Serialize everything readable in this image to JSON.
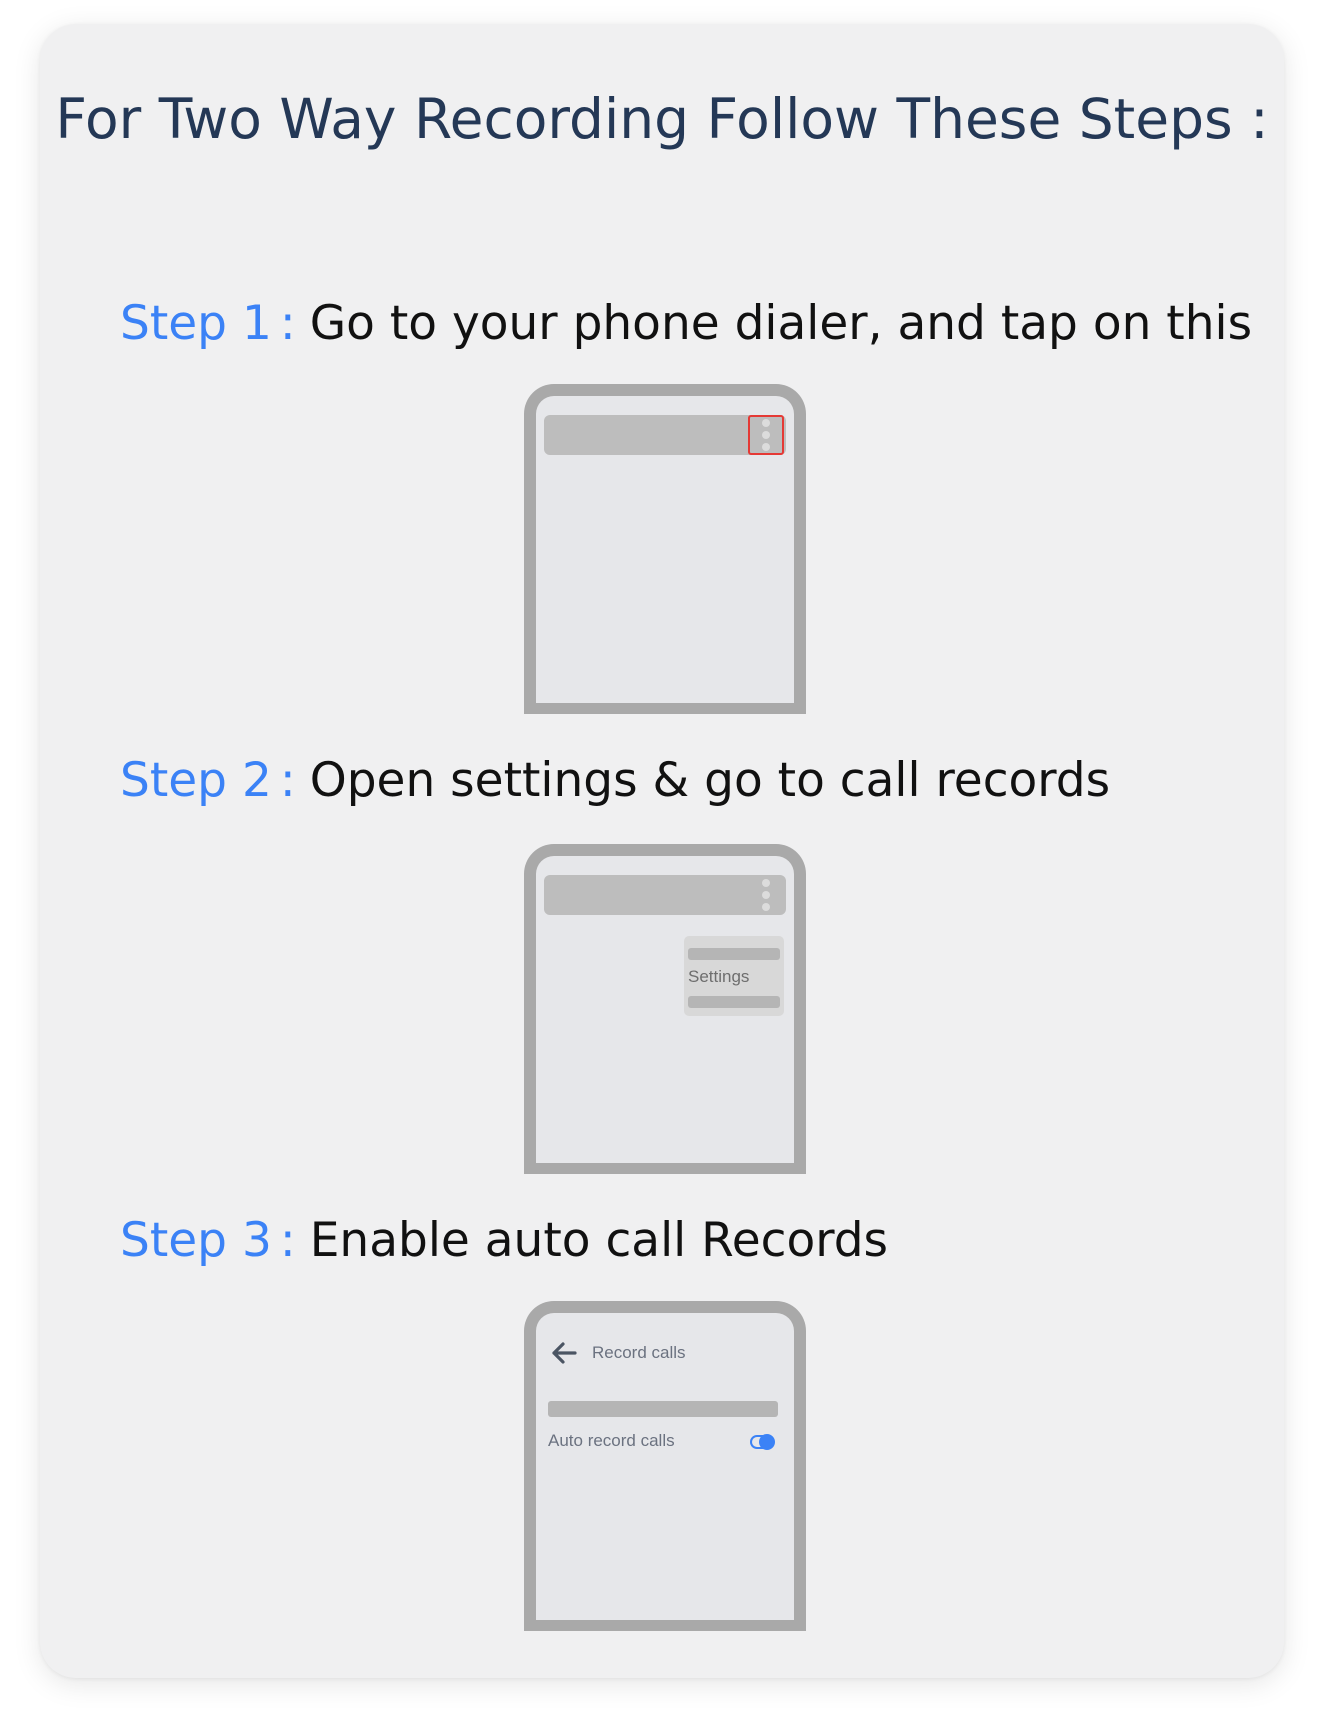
{
  "title": "For Two Way Recording Follow These Steps :",
  "steps": [
    {
      "label": "Step 1",
      "separator": ":",
      "text": "Go to your phone dialer, and tap on this"
    },
    {
      "label": "Step 2",
      "separator": ":",
      "text": "Open settings & go to call records"
    },
    {
      "label": "Step 3",
      "separator": ":",
      "text": "Enable auto call Records"
    }
  ],
  "phone2": {
    "menu_item": "Settings"
  },
  "phone3": {
    "screen_title": "Record calls",
    "toggle_label": "Auto record calls",
    "toggle_on": true
  },
  "colors": {
    "accent": "#3b82f6",
    "title": "#243856",
    "highlight": "#e53935",
    "phone_frame": "#a9a9a9",
    "card_bg": "#f0f0f1"
  }
}
